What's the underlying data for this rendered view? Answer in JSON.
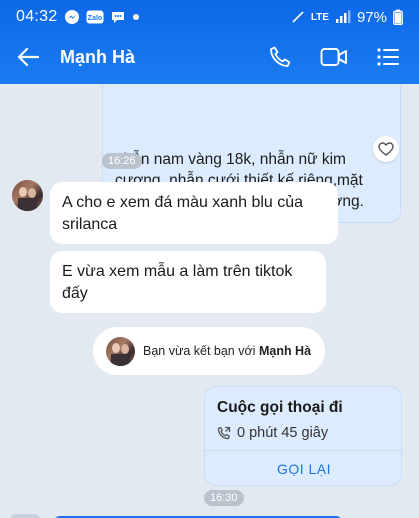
{
  "status_bar": {
    "time": "04:32",
    "network": "LTE",
    "battery": "97%"
  },
  "header": {
    "contact_name": "Mạnh Hà"
  },
  "messages": {
    "outgoing_text": "nhẫn nam vàng 18k, nhẫn nữ kim cương, nhẫn cưới thiết kế riêng,mặt dây chuyền cao cấp nhất thị trường.",
    "time_1": "16:26",
    "incoming_1": "A cho e xem đá màu xanh blu của srilanca",
    "incoming_2": "E vừa xem mẫu a làm trên tiktok đấy",
    "system_prefix": "Bạn vừa kết bạn với",
    "system_name": "Mạnh Hà",
    "call_title": "Cuộc gọi thoại đi",
    "call_duration": "0 phút 45 giây",
    "call_back": "GỌI LẠI",
    "time_2": "16:30"
  },
  "colors": {
    "header": "#1a7cf0",
    "outgoing_bubble": "#dcecfe",
    "chat_bg": "#e3e9f1",
    "accent": "#1a73e8"
  }
}
